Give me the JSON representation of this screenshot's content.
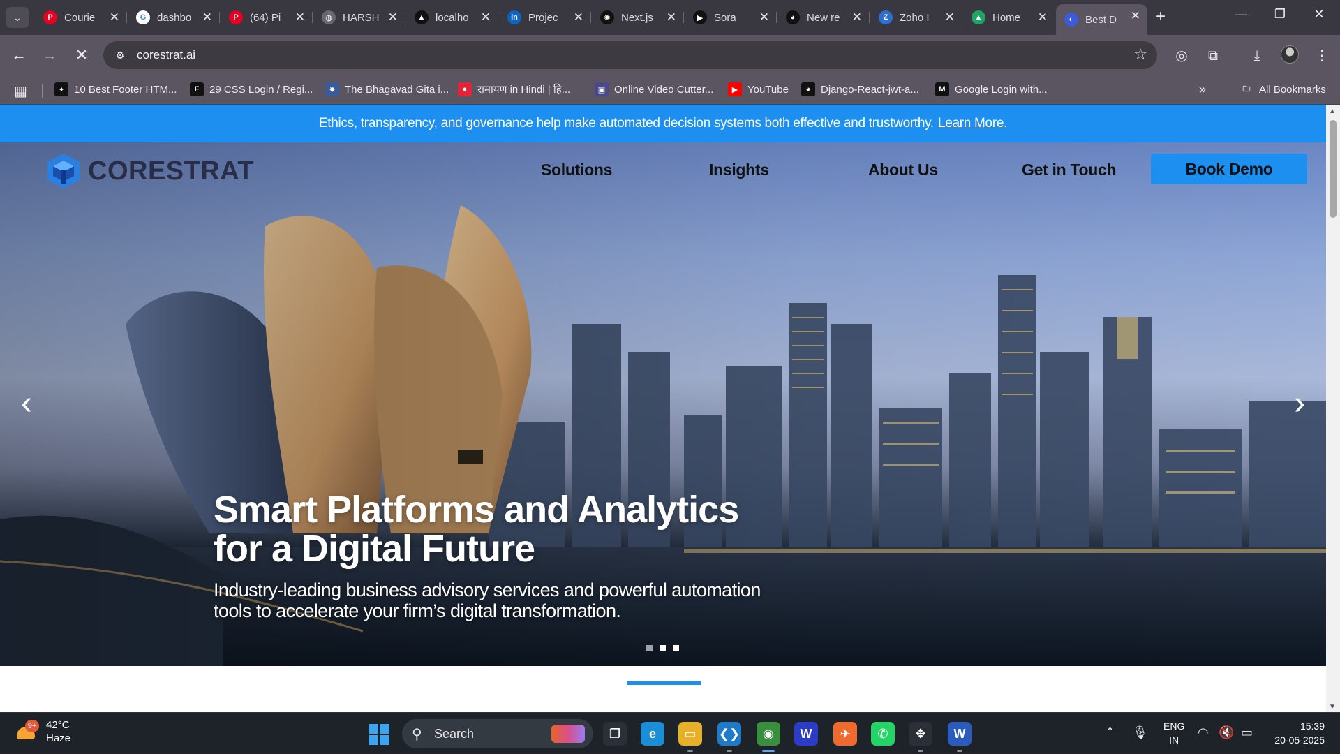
{
  "browser": {
    "tabs": [
      {
        "title": "Courie",
        "icon": "pinterest-icon",
        "color": "#e60023",
        "glyph": "P"
      },
      {
        "title": "dashbo",
        "icon": "google-icon",
        "color": "#ffffff",
        "glyph": "G"
      },
      {
        "title": "(64) Pi",
        "icon": "pinterest-icon",
        "color": "#e60023",
        "glyph": "P"
      },
      {
        "title": "HARSH",
        "icon": "globe-icon",
        "color": "#6a6770",
        "glyph": "◍"
      },
      {
        "title": "localho",
        "icon": "vercel-icon",
        "color": "#111111",
        "glyph": "▲"
      },
      {
        "title": "Projec",
        "icon": "linkedin-icon",
        "color": "#0a66c2",
        "glyph": "in"
      },
      {
        "title": "Next.js",
        "icon": "openai-icon",
        "color": "#111111",
        "glyph": "✺"
      },
      {
        "title": "Sora",
        "icon": "play-icon",
        "color": "#111111",
        "glyph": "▶"
      },
      {
        "title": "New re",
        "icon": "github-icon",
        "color": "#111111",
        "glyph": "◕"
      },
      {
        "title": "Zoho I",
        "icon": "zoho-icon",
        "color": "#2c6fd0",
        "glyph": "Z"
      },
      {
        "title": "Home",
        "icon": "google-drive-icon",
        "color": "#1fa463",
        "glyph": "▲"
      },
      {
        "title": "Best D",
        "icon": "site-loading-icon",
        "color": "#3b5bdb",
        "glyph": "◐"
      }
    ],
    "url": "corestrat.ai",
    "bookmarks": [
      {
        "label": "10 Best Footer HTM...",
        "icon": "footer-bookmark-icon",
        "glyph": "✦",
        "bg": "#111111"
      },
      {
        "label": "29 CSS Login / Regi...",
        "icon": "freefrontend-icon",
        "glyph": "F",
        "bg": "#111111"
      },
      {
        "label": "The Bhagavad Gita i...",
        "icon": "gita-icon",
        "glyph": "✸",
        "bg": "#3a5b9a"
      },
      {
        "label": "रामायण in Hindi | हि...",
        "icon": "ramayan-icon",
        "glyph": "●",
        "bg": "#e0243a"
      },
      {
        "label": "Online Video Cutter...",
        "icon": "video-cutter-icon",
        "glyph": "▣",
        "bg": "#4a4a8a"
      },
      {
        "label": "YouTube",
        "icon": "youtube-icon",
        "glyph": "▶",
        "bg": "#ff0000"
      },
      {
        "label": "Django-React-jwt-a...",
        "icon": "github-icon",
        "glyph": "◕",
        "bg": "#111111"
      },
      {
        "label": "Google Login with...",
        "icon": "medium-icon",
        "glyph": "M",
        "bg": "#111111"
      }
    ],
    "all_bookmarks": "All Bookmarks"
  },
  "site": {
    "announcement": "Ethics, transparency, and governance help make automated decision systems both effective and trustworthy.",
    "announcement_link": "Learn More.",
    "logo_text": "CORESTRAT",
    "nav": [
      "Solutions",
      "Insights",
      "About Us",
      "Get in Touch"
    ],
    "cta": "Book Demo",
    "hero_title_1": "Smart Platforms and Analytics",
    "hero_title_2": "for a Digital Future",
    "hero_sub_1": "Industry-leading business advisory services and powerful automation",
    "hero_sub_2": "tools to accelerate your firm’s digital transformation.",
    "slides": 3,
    "active_slide": 3,
    "brand_color": "#1c8ff0"
  },
  "taskbar": {
    "weather_temp": "42°C",
    "weather_desc": "Haze",
    "weather_badge": "9+",
    "search": "Search",
    "apps": [
      {
        "name": "task-view-icon",
        "glyph": "❐",
        "bg": "#2b3038"
      },
      {
        "name": "edge-icon",
        "glyph": "e",
        "bg": "#1a8fd8"
      },
      {
        "name": "file-explorer-icon",
        "glyph": "▭",
        "bg": "#e8b02a"
      },
      {
        "name": "vscode-icon",
        "glyph": "❮❯",
        "bg": "#1f7acb"
      },
      {
        "name": "chrome-icon",
        "glyph": "◉",
        "bg": "#3a8f3e"
      },
      {
        "name": "webex-icon",
        "glyph": "W",
        "bg": "#2b3cc9"
      },
      {
        "name": "postman-icon",
        "glyph": "✈",
        "bg": "#ef6a2e"
      },
      {
        "name": "whatsapp-icon",
        "glyph": "✆",
        "bg": "#25d366"
      },
      {
        "name": "figma-icon",
        "glyph": "✥",
        "bg": "#2b3038"
      },
      {
        "name": "word-icon",
        "glyph": "W",
        "bg": "#2b5bbd"
      }
    ],
    "lang_1": "ENG",
    "lang_2": "IN",
    "time": "15:39",
    "date": "20-05-2025"
  }
}
